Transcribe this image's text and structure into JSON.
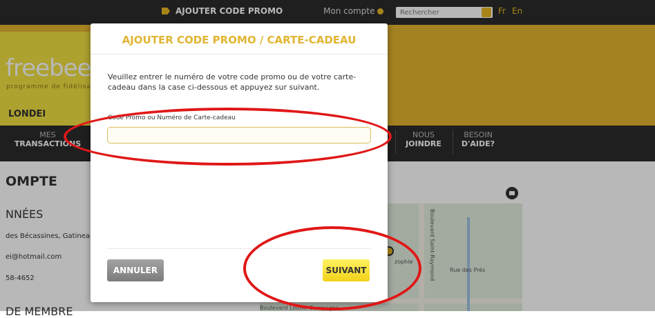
{
  "topbar": {
    "promo_label": "AJOUTER CODE PROMO",
    "account_label": "Mon compte",
    "search_placeholder": "Rechercher",
    "lang_fr": "Fr",
    "lang_en": "En"
  },
  "brand": {
    "logo_text": "freebee",
    "logo_tagline": "programme de fidélisation",
    "member_name": "LONDEI"
  },
  "nav": {
    "items": [
      {
        "small": "MES",
        "big": "TRANSACTIONS"
      },
      {
        "small": "NOUS",
        "big": "JOINDRE"
      },
      {
        "small": "BESOIN",
        "big": "D'AIDE?"
      }
    ]
  },
  "account": {
    "title": "OMPTE",
    "data_heading": "NNÉES",
    "address": "des Bécassines, Gatineau,",
    "email": "ei@hotmail.com",
    "phone": "58-4652",
    "member_heading": "DE MEMBRE"
  },
  "map": {
    "road_vertical": "Boulevard Saint-Raymond",
    "street": "Rue des Prés",
    "road_bottom": "Boulevard Louise-Campagna",
    "place": "zophie"
  },
  "modal": {
    "title": "AJOUTER CODE PROMO / CARTE-CADEAU",
    "description": "Veuillez entrer le numéro de votre code promo ou de votre carte-cadeau dans la case ci-dessous et appuyez sur suivant.",
    "field_label": "Code Promo ou Numéro de Carte-cadeau",
    "field_value": "",
    "cancel_label": "ANNULER",
    "next_label": "SUIVANT"
  },
  "colors": {
    "accent_yellow": "#e4b52e",
    "title_gold": "#e1b531",
    "dark_bar": "#2b2b2b",
    "annotation_red": "#e01717"
  }
}
